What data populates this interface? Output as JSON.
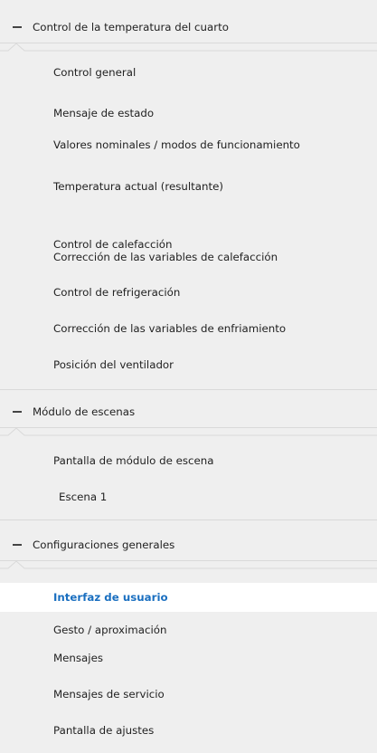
{
  "sections": [
    {
      "title": "Control de la temperatura del cuarto",
      "items": [
        "Control general",
        "Mensaje de estado",
        "Valores nominales / modos de funcionamiento",
        "Temperatura actual (resultante)",
        "Control de calefacción",
        "Corrección de las variables de calefacción",
        "Control de refrigeración",
        "Corrección de las variables de enfriamiento",
        "Posición del ventilador"
      ]
    },
    {
      "title": "Módulo de escenas",
      "items": [
        "Pantalla de módulo de escena",
        "Escena 1"
      ]
    },
    {
      "title": "Configuraciones generales",
      "items": [
        "Interfaz de usuario",
        "Gesto / aproximación",
        "Mensajes",
        "Mensajes de servicio",
        "Pantalla de ajustes"
      ]
    }
  ],
  "selected_item": "Interfaz de usuario",
  "colors": {
    "background": "#efefef",
    "selected_background": "#ffffff",
    "selected_text": "#1a6fc0",
    "divider": "#d9d9d9"
  },
  "icons": {
    "section_toggle": "minus-collapse-icon"
  }
}
